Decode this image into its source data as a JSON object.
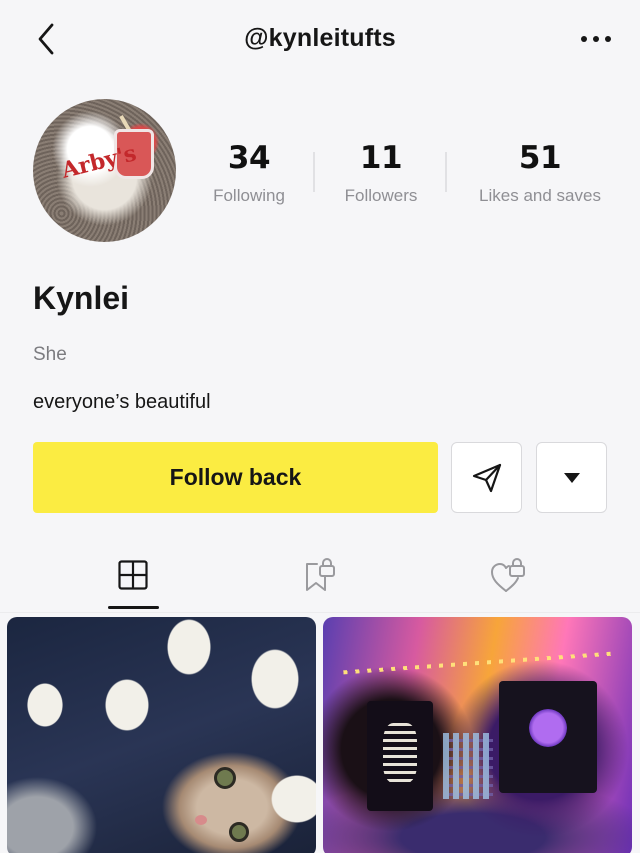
{
  "header": {
    "username": "@kynleitufts",
    "back_icon": "chevron-left-icon",
    "more_icon": "more-horizontal-icon"
  },
  "profile": {
    "name": "Kynlei",
    "pronoun": "She",
    "bio": "everyone’s beautiful",
    "avatar_icon": "avatar",
    "avatar_logo_text": "Arby's"
  },
  "stats": {
    "following": {
      "value": "34",
      "label": "Following"
    },
    "followers": {
      "value": "11",
      "label": "Followers"
    },
    "likes": {
      "value": "51",
      "label": "Likes and saves"
    }
  },
  "actions": {
    "follow_label": "Follow back",
    "follow_color": "#fbec42",
    "share_icon": "send-icon",
    "dropdown_icon": "caret-down-icon"
  },
  "tabs": [
    {
      "name": "posts",
      "icon": "grid-layout-icon",
      "active": true
    },
    {
      "name": "saved",
      "icon": "bookmark-lock-icon",
      "active": false
    },
    {
      "name": "liked",
      "icon": "heart-lock-icon",
      "active": false
    }
  ],
  "grid": {
    "items": [
      {
        "subject": "kitten on polka-dot blanket"
      },
      {
        "subject": "room with neon lights and tapestries"
      }
    ]
  }
}
